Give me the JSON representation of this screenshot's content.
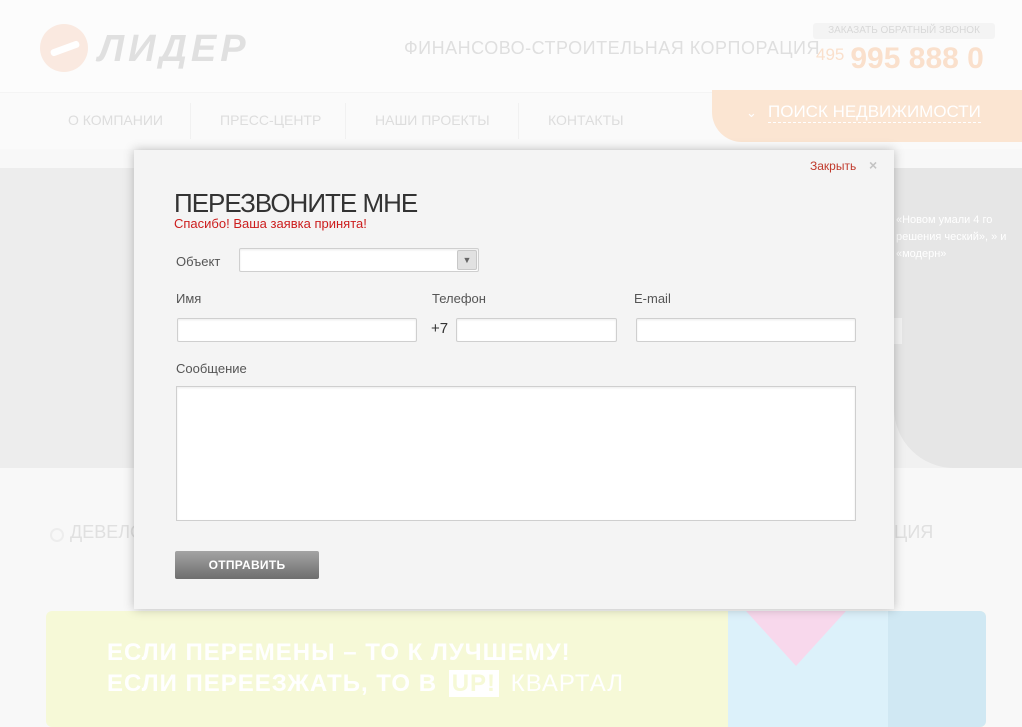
{
  "header": {
    "logo_text": "ЛИДЕР",
    "tagline": "ФИНАНСОВО-СТРОИТЕЛЬНАЯ КОРПОРАЦИЯ",
    "callback_label": "ЗАКАЗАТЬ ОБРАТНЫЙ ЗВОНОК",
    "phone_code": "495",
    "phone_number": "995 888 0"
  },
  "nav": {
    "items": [
      "О КОМПАНИИ",
      "ПРЕСС-ЦЕНТР",
      "НАШИ ПРОЕКТЫ",
      "КОНТАКТЫ"
    ],
    "search_label": "ПОИСК НЕДВИЖИМОСТИ"
  },
  "banner": {
    "text": "«Новом умали 4 го решения ческий», » и «модерн»"
  },
  "tabs": {
    "left": "ДЕВЕЛО",
    "right": "ЦИЯ"
  },
  "promo": {
    "line1": "ЕСЛИ ПЕРЕМЕНЫ – ТО К ЛУЧШЕМУ!",
    "line2_prefix": "ЕСЛИ ПЕРЕЕЗЖАТЬ, ТО В",
    "line2_badge": "UP!",
    "line2_suffix": "КВАРТАЛ"
  },
  "modal": {
    "close_label": "Закрыть",
    "close_icon": "×",
    "title": "ПЕРЕЗВОНИТЕ МНЕ",
    "success_message": "Спасибо! Ваша заявка принята!",
    "object_label": "Объект",
    "object_value": "",
    "name_label": "Имя",
    "name_value": "",
    "phone_label": "Телефон",
    "phone_prefix": "+7",
    "phone_value": "",
    "email_label": "E-mail",
    "email_value": "",
    "message_label": "Сообщение",
    "message_value": "",
    "submit_label": "ОТПРАВИТЬ"
  },
  "colors": {
    "accent_orange": "#f8cfae",
    "error_red": "#cc1d1d",
    "promo_green": "#eef5b7"
  }
}
